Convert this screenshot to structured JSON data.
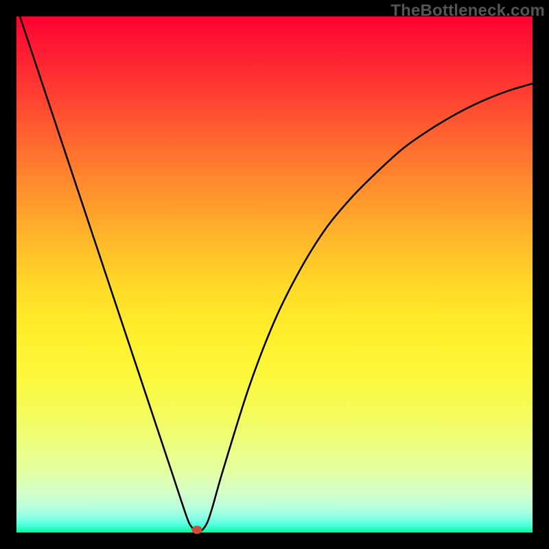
{
  "watermark": "TheBottleneck.com",
  "chart_data": {
    "type": "line",
    "title": "",
    "xlabel": "",
    "ylabel": "",
    "xlim": [
      0,
      100
    ],
    "ylim": [
      0,
      100
    ],
    "background_gradient": {
      "top": "#ff0030",
      "bottom": "#00ff99",
      "meaning": "red=bad, green=good"
    },
    "series": [
      {
        "name": "bottleneck-curve",
        "x": [
          0,
          5,
          10,
          15,
          20,
          25,
          30,
          33,
          34,
          35,
          36,
          37,
          38,
          40,
          45,
          50,
          55,
          60,
          65,
          70,
          75,
          80,
          85,
          90,
          95,
          100
        ],
        "y": [
          102,
          87,
          72,
          57,
          42,
          27,
          12,
          3,
          1,
          0,
          0.5,
          2,
          5,
          12,
          28,
          41,
          51,
          59,
          65,
          70,
          74.5,
          78,
          81,
          83.5,
          85.5,
          87
        ]
      }
    ],
    "marker": {
      "x": 35,
      "y": 0.5,
      "color": "#CF4B3A"
    },
    "curve_style": {
      "stroke": "#000000",
      "stroke_width": 2.6
    }
  }
}
